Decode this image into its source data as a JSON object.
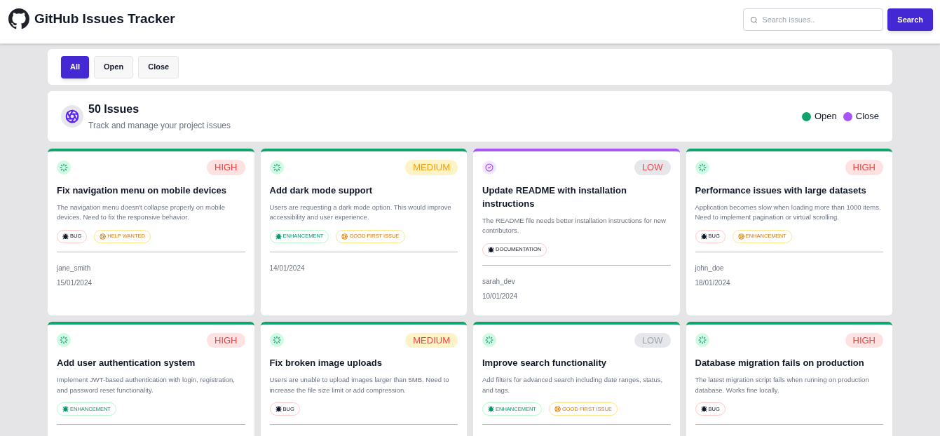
{
  "header": {
    "title": "GitHub Issues Tracker",
    "search": {
      "placeholder": "Search issues.."
    },
    "search_button": "Search"
  },
  "filters": [
    {
      "label": "All",
      "selected": true
    },
    {
      "label": "Open",
      "selected": false
    },
    {
      "label": "Close",
      "selected": false
    }
  ],
  "summary": {
    "title": "50 Issues",
    "subtitle": "Track and manage your project issues",
    "legend": [
      {
        "label": "Open",
        "color": "#10a36b"
      },
      {
        "label": "Close",
        "color": "#a855f7"
      }
    ]
  },
  "issues": [
    {
      "closed": false,
      "priority": {
        "text": "HIGH",
        "kind": "high",
        "color": "#ef4444"
      },
      "title": "Fix navigation menu on mobile devices",
      "description": "The navigation menu doesn't collapse properly on mobile devices. Need to fix the responsive behavior.",
      "labels": [
        {
          "text": "BUG",
          "kind": "danger"
        },
        {
          "text": "HELP WANTED",
          "kind": "warning"
        }
      ],
      "author": "jane_smith",
      "date": "15/01/2024"
    },
    {
      "closed": false,
      "priority": {
        "text": "MEDIUM",
        "kind": "medium",
        "color": "#f59e0b"
      },
      "title": "Add dark mode support",
      "description": "Users are requesting a dark mode option. This would improve accessibility and user experience.",
      "labels": [
        {
          "text": "ENHANCEMENT",
          "kind": "success"
        },
        {
          "text": "GOOD FIRST ISSUE",
          "kind": "warning"
        }
      ],
      "date": "14/01/2024"
    },
    {
      "closed": true,
      "priority": {
        "text": "LOW",
        "kind": "low",
        "color": "#ef4444"
      },
      "title": "Update README with installation instructions",
      "description": "The README file needs better installation instructions for new contributors.",
      "labels": [
        {
          "text": "DOCUMENTATION",
          "kind": "danger"
        }
      ],
      "author": "sarah_dev",
      "date": "10/01/2024"
    },
    {
      "closed": false,
      "priority": {
        "text": "HIGH",
        "kind": "high",
        "color": "#ef4444"
      },
      "title": "Performance issues with large datasets",
      "description": "Application becomes slow when loading more than 1000 items. Need to implement pagination or virtual scrolling.",
      "labels": [
        {
          "text": "BUG",
          "kind": "danger"
        },
        {
          "text": "ENHANCEMENT",
          "kind": "warning"
        }
      ],
      "author": "john_doe",
      "date": "18/01/2024"
    },
    {
      "closed": false,
      "priority": {
        "text": "HIGH",
        "kind": "high",
        "color": "#ef4444"
      },
      "title": "Add user authentication system",
      "description": "Implement JWT-based authentication with login, registration, and password reset functionality.",
      "labels": [
        {
          "text": "ENHANCEMENT",
          "kind": "success"
        }
      ]
    },
    {
      "closed": false,
      "priority": {
        "text": "MEDIUM",
        "kind": "medium",
        "color": "#ef4444"
      },
      "title": "Fix broken image uploads",
      "description": "Users are unable to upload images larger than 5MB. Need to increase the file size limit or add compression.",
      "labels": [
        {
          "text": "BUG",
          "kind": "danger"
        }
      ]
    },
    {
      "closed": false,
      "priority": {
        "text": "LOW",
        "kind": "low",
        "color": "#9ca3af"
      },
      "title": "Improve search functionality",
      "description": "Add filters for advanced search including date ranges, status, and tags.",
      "labels": [
        {
          "text": "ENHANCEMENT",
          "kind": "success"
        },
        {
          "text": "GOOD FIRST ISSUE",
          "kind": "warning"
        }
      ]
    },
    {
      "closed": false,
      "priority": {
        "text": "HIGH",
        "kind": "high",
        "color": "#ef4444"
      },
      "title": "Database migration fails on production",
      "description": "The latest migration script fails when running on production database. Works fine locally.",
      "labels": [
        {
          "text": "BUG",
          "kind": "danger"
        }
      ]
    }
  ]
}
